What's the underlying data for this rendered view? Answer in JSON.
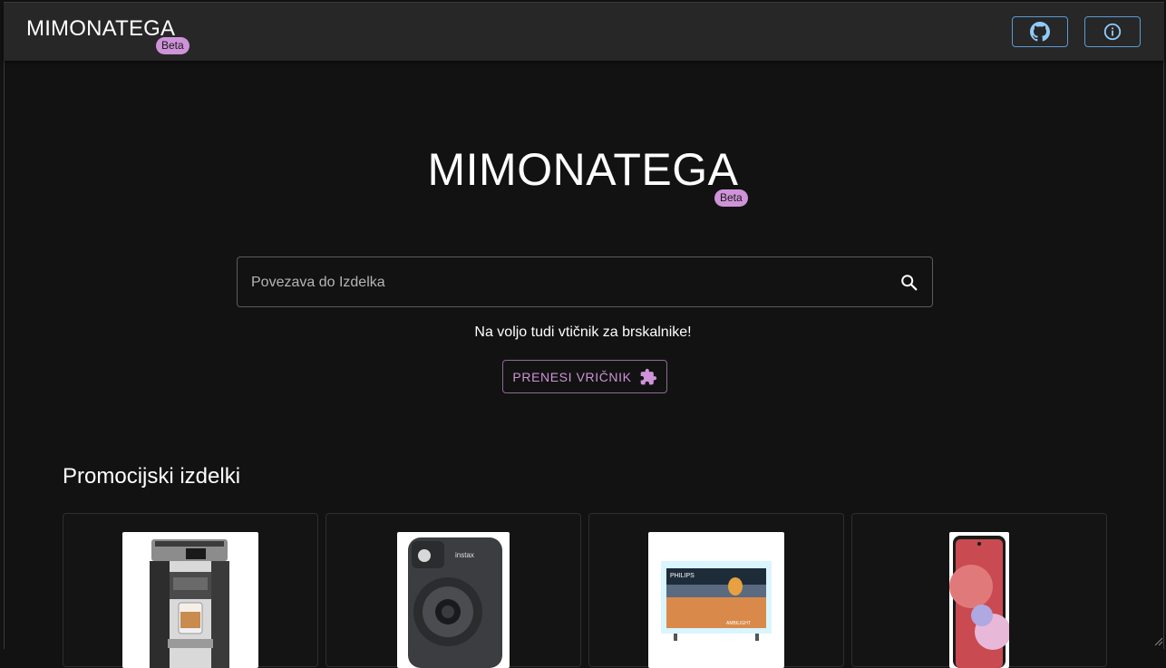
{
  "appbar": {
    "brand": "MIMONATEGA",
    "badge": "Beta",
    "github_icon": "github-icon",
    "info_icon": "info-icon"
  },
  "hero": {
    "title": "MIMONATEGA",
    "badge": "Beta"
  },
  "search": {
    "placeholder": "Povezava do Izdelka",
    "icon": "search-icon"
  },
  "extension": {
    "hint": "Na voljo tudi vtičnik za brskalnike!",
    "button_label": "PRENESI VRIČNIK",
    "icon": "puzzle-icon"
  },
  "promo": {
    "title": "Promocijski izdelki",
    "products": [
      {
        "name": "coffee-machine"
      },
      {
        "name": "instant-camera"
      },
      {
        "name": "television"
      },
      {
        "name": "smartphone"
      }
    ]
  },
  "colors": {
    "accent": "#ce93d8",
    "icon_blue": "#90caf9",
    "appbar": "#272727",
    "background": "#121212"
  }
}
